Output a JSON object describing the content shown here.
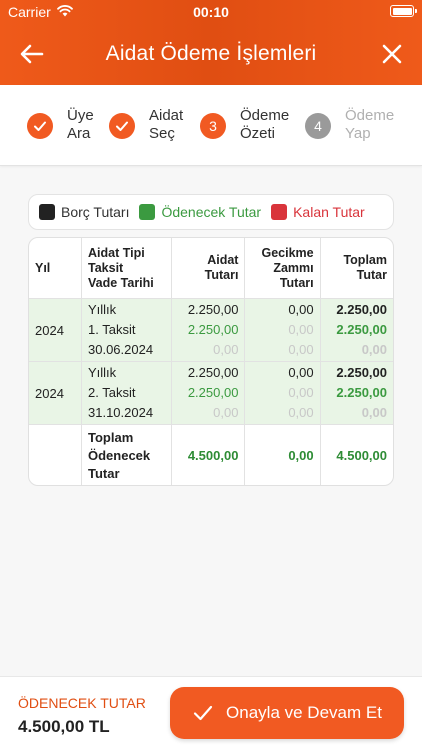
{
  "status": {
    "carrier": "Carrier",
    "time": "00:10"
  },
  "nav": {
    "title": "Aidat Ödeme İşlemleri"
  },
  "steps": [
    {
      "number": "",
      "label": "Üye\nAra",
      "state": "done"
    },
    {
      "number": "",
      "label": "Aidat\nSeç",
      "state": "done"
    },
    {
      "number": "3",
      "label": "Ödeme\nÖzeti",
      "state": "current"
    },
    {
      "number": "4",
      "label": "Ödeme\nYap",
      "state": "pending"
    }
  ],
  "legend": [
    {
      "label": "Borç Tutarı",
      "color": "#222222"
    },
    {
      "label": "Ödenecek Tutar",
      "color": "#3b9a40"
    },
    {
      "label": "Kalan Tutar",
      "color": "#d9343b"
    }
  ],
  "colors": {
    "accent": "#f15a22",
    "paid_green": "#3b9a40",
    "remaining_red": "#d9343b",
    "row_bg": "#e9f5e6"
  },
  "table": {
    "headers": [
      "Yıl",
      "Aidat Tipi\nTaksit\nVade Tarihi",
      "Aidat\nTutarı",
      "Gecikme\nZammı\nTutarı",
      "Toplam\nTutar"
    ],
    "rows": [
      {
        "year": "2024",
        "type": "Yıllık",
        "installment": "1. Taksit",
        "due": "30.06.2024",
        "aidat": [
          "2.250,00",
          "2.250,00",
          "0,00"
        ],
        "gecikme": [
          "0,00",
          "0,00",
          "0,00"
        ],
        "toplam": [
          "2.250,00",
          "2.250,00",
          "0,00"
        ]
      },
      {
        "year": "2024",
        "type": "Yıllık",
        "installment": "2. Taksit",
        "due": "31.10.2024",
        "aidat": [
          "2.250,00",
          "2.250,00",
          "0,00"
        ],
        "gecikme": [
          "0,00",
          "0,00",
          "0,00"
        ],
        "toplam": [
          "2.250,00",
          "2.250,00",
          "0,00"
        ]
      }
    ],
    "total": {
      "label": "Toplam\nÖdenecek\nTutar",
      "aidat": "4.500,00",
      "gecikme": "0,00",
      "toplam": "4.500,00"
    }
  },
  "footer": {
    "label": "ÖDENECEK TUTAR",
    "amount": "4.500,00 TL",
    "button": "Onayla ve Devam Et"
  }
}
